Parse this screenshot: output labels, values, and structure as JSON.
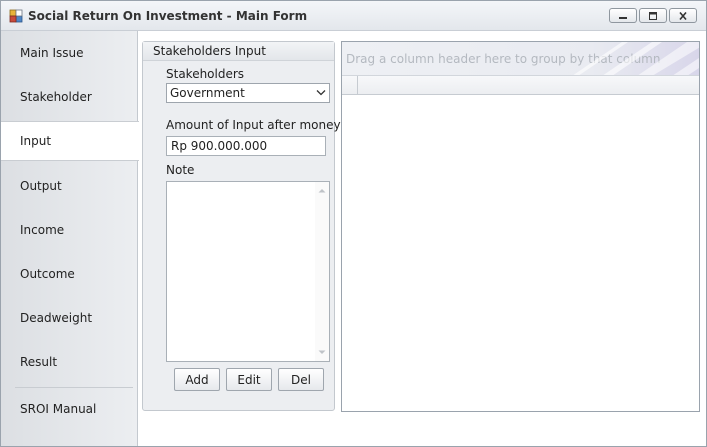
{
  "window": {
    "title": "Social Return On Investment - Main Form"
  },
  "nav": {
    "items": [
      {
        "label": "Main Issue"
      },
      {
        "label": "Stakeholder"
      },
      {
        "label": "Input"
      },
      {
        "label": "Output"
      },
      {
        "label": "Income"
      },
      {
        "label": "Outcome"
      },
      {
        "label": "Deadweight"
      },
      {
        "label": "Result"
      },
      {
        "label": "SROI Manual"
      }
    ],
    "active": "Input"
  },
  "form": {
    "group_title": "Stakeholders Input",
    "stakeholders_label": "Stakeholders",
    "stakeholders_value": "Government",
    "amount_label": "Amount of Input after moneytize",
    "amount_value": "Rp 900.000.000",
    "note_label": "Note",
    "note_value": "",
    "buttons": {
      "add": "Add",
      "edit": "Edit",
      "del": "Del"
    }
  },
  "grid": {
    "group_panel_text": "Drag a column header here to group by that column"
  },
  "colors": {
    "titlebar": "#e9ecf0",
    "nav_background": "#e4e6e9",
    "accent_panel": "#d8d6ea"
  },
  "icons": {
    "app": "app-icon",
    "minimize": "minimize-icon",
    "maximize": "maximize-icon",
    "close": "close-icon",
    "dropdown": "chevron-down-icon"
  }
}
